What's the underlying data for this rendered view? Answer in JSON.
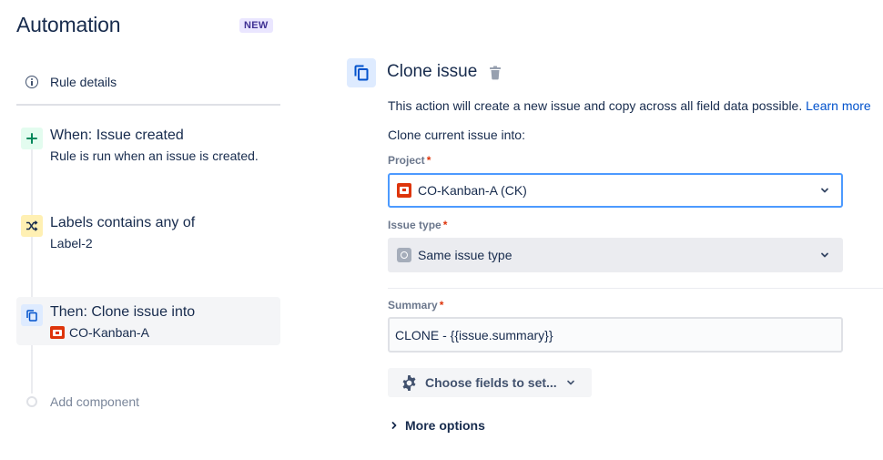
{
  "app": {
    "title": "Automation",
    "badge": "NEW"
  },
  "sidebar": {
    "rule_details": "Rule details",
    "components": [
      {
        "title": "When: Issue created",
        "subtitle": "Rule is run when an issue is created.",
        "icon": "plus-icon",
        "color": "#00875A"
      },
      {
        "title": "Labels contains any of",
        "subtitle": "Label-2",
        "icon": "shuffle-icon",
        "color": "#FF991F"
      },
      {
        "title": "Then: Clone issue into",
        "subtitle": "CO-Kanban-A",
        "icon": "clone-icon",
        "color": "#0052CC"
      }
    ],
    "add_component": "Add component"
  },
  "panel": {
    "title": "Clone issue",
    "description": "This action will create a new issue and copy across all field data possible.",
    "learn_more": "Learn more",
    "clone_into": "Clone current issue into:",
    "project": {
      "label": "Project",
      "required": "*",
      "value": "CO-Kanban-A (CK)"
    },
    "issue_type": {
      "label": "Issue type",
      "required": "*",
      "value": "Same issue type"
    },
    "summary": {
      "label": "Summary",
      "required": "*",
      "value": "CLONE - {{issue.summary}}"
    },
    "choose_fields": "Choose fields to set...",
    "more_options": "More options"
  }
}
